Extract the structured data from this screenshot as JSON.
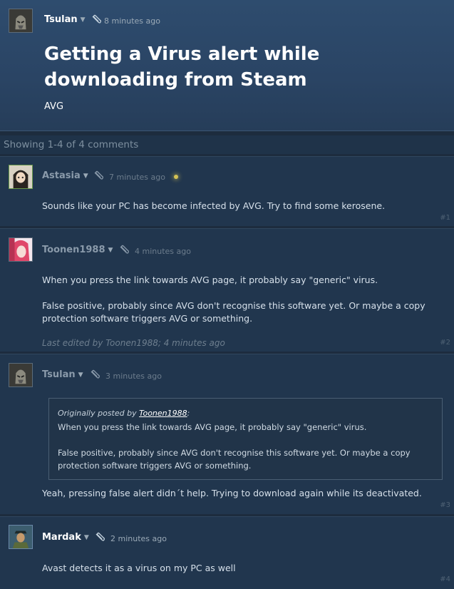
{
  "topic": {
    "author": "Tsulan",
    "time": "8 minutes ago",
    "title": "Getting a Virus alert while downloading from Steam",
    "subtitle": "AVG"
  },
  "showing": "Showing 1-4 of 4 comments",
  "comments": [
    {
      "author": "Astasia",
      "time": "7 minutes ago",
      "text": "Sounds like your PC has become infected by AVG. Try to find some kerosene.",
      "num": "#1"
    },
    {
      "author": "Toonen1988",
      "time": "4 minutes ago",
      "text1": "When you press the link towards AVG page, it probably say \"generic\" virus.",
      "text2a": "False positive, probably since AVG don't recognise this software yet. Or maybe a copy",
      "text2b": "protection software triggers AVG or something.",
      "edited": "Last edited by Toonen1988; 4 minutes ago",
      "num": "#2"
    },
    {
      "author": "Tsulan",
      "time": "3 minutes ago",
      "quote_prefix": "Originally posted by ",
      "quote_author": "Toonen1988",
      "quote_suffix": ":",
      "quote1": "When you press the link towards AVG page, it probably say \"generic\" virus.",
      "quote2a": "False positive, probably since AVG don't recognise this software yet. Or maybe a copy",
      "quote2b": "protection software triggers AVG or something.",
      "text": "Yeah, pressing false alert didn´t help. Trying to download again while its deactivated.",
      "num": "#3"
    },
    {
      "author": "Mardak",
      "time": "2 minutes ago",
      "text": "Avast detects it as a virus on my PC as well",
      "num": "#4"
    }
  ],
  "colors": {
    "header_bg": "#2e4c6e",
    "comment_bg": "#21364e",
    "text": "#d6e0ea"
  }
}
